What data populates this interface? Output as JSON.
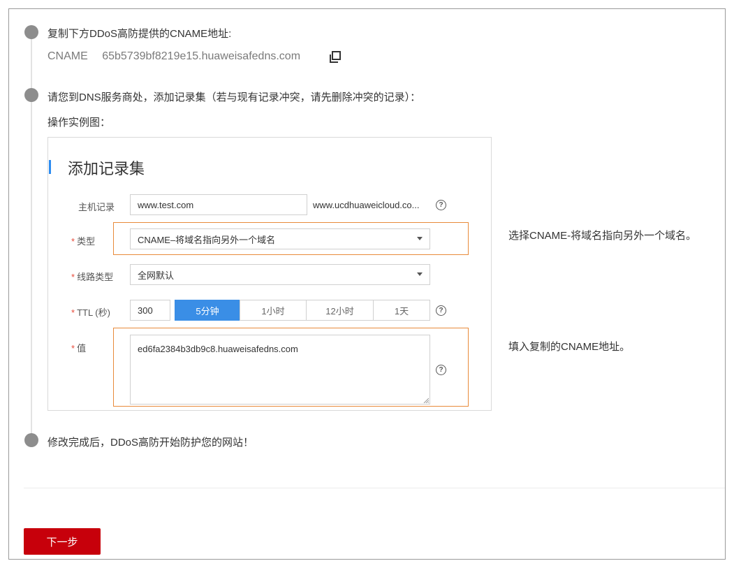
{
  "steps": {
    "step1": "复制下方DDoS高防提供的CNAME地址:",
    "cname_label": "CNAME",
    "cname_value": "65b5739bf8219e15.huaweisafedns.com",
    "step2": "请您到DNS服务商处，添加记录集（若与现有记录冲突，请先删除冲突的记录）：",
    "step2_sub": "操作实例图：",
    "step3": "修改完成后，DDoS高防开始防护您的网站！"
  },
  "example": {
    "title": "添加记录集",
    "host_label": "主机记录",
    "host_value": "www.test.com",
    "host_suffix": "www.ucdhuaweicloud.co...",
    "type_label": "类型",
    "type_value": "CNAME–将域名指向另外一个域名",
    "line_label": "线路类型",
    "line_value": "全网默认",
    "ttl_label": "TTL (秒)",
    "ttl_value": "300",
    "ttl_options": [
      "5分钟",
      "1小时",
      "12小时",
      "1天"
    ],
    "value_label": "值",
    "value_text": "ed6fa2384b3db9c8.huaweisafedns.com",
    "required_mark": "*",
    "help_glyph": "?"
  },
  "notes": {
    "type_note": "选择CNAME-将域名指向另外一个域名。",
    "value_note": "填入复制的CNAME地址。"
  },
  "actions": {
    "next_label": "下一步"
  },
  "colors": {
    "accent_blue": "#3a8ee6",
    "highlight_orange": "#e88a3a",
    "primary_red": "#c7000b",
    "dot_gray": "#8d8d8d"
  },
  "icons": {
    "copy": "copy-icon",
    "help": "help-icon",
    "dropdown": "chevron-down-icon"
  }
}
